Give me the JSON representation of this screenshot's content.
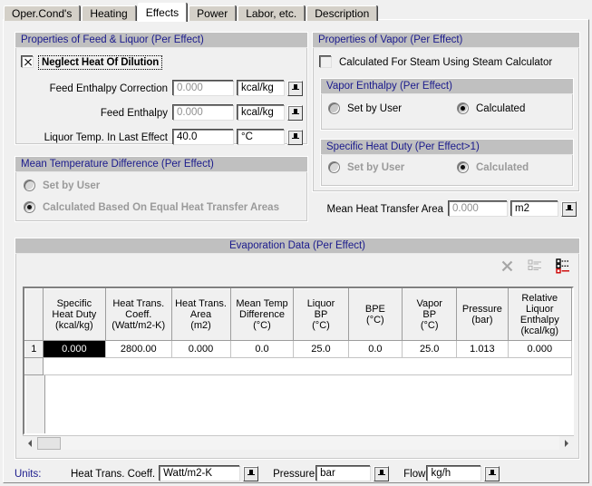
{
  "window": {
    "title": "Effects"
  },
  "tabs": [
    {
      "label": "Oper.Cond's",
      "active": false
    },
    {
      "label": "Heating",
      "active": false
    },
    {
      "label": "Effects",
      "active": true
    },
    {
      "label": "Power",
      "active": false
    },
    {
      "label": "Labor, etc.",
      "active": false
    },
    {
      "label": "Description",
      "active": false
    }
  ],
  "feed_liquor": {
    "title": "Properties of Feed & Liquor (Per Effect)",
    "neglect_checkbox": {
      "label": "Neglect Heat Of Dilution",
      "checked": true,
      "focused": true
    },
    "rows": [
      {
        "label": "Feed Enthalpy Correction",
        "value": "0.000",
        "unit": "kcal/kg",
        "disabled": true
      },
      {
        "label": "Feed Enthalpy",
        "value": "0.000",
        "unit": "kcal/kg",
        "disabled": true
      },
      {
        "label": "Liquor Temp. In Last Effect",
        "value": "40.0",
        "unit": "°C",
        "disabled": false
      }
    ]
  },
  "mean_temp_diff": {
    "title": "Mean Temperature Difference (Per Effect)",
    "options": [
      {
        "label": "Set by User",
        "selected": false,
        "disabled": true
      },
      {
        "label": "Calculated Based On Equal Heat Transfer Areas",
        "selected": true,
        "disabled": true
      }
    ]
  },
  "vapor": {
    "title": "Properties of Vapor (Per Effect)",
    "steam_checkbox": {
      "label": "Calculated For Steam Using Steam Calculator",
      "checked": false,
      "disabled": true
    },
    "vapor_enthalpy": {
      "title": "Vapor Enthalpy (Per Effect)",
      "options": [
        {
          "label": "Set by User",
          "selected": false,
          "disabled": false
        },
        {
          "label": "Calculated",
          "selected": true,
          "disabled": false
        }
      ]
    },
    "specific_heat_duty": {
      "title": "Specific Heat Duty (Per Effect>1)",
      "options": [
        {
          "label": "Set by User",
          "selected": false,
          "disabled": true
        },
        {
          "label": "Calculated",
          "selected": true,
          "disabled": true
        }
      ]
    }
  },
  "mean_heat_transfer_area": {
    "label": "Mean Heat Transfer Area",
    "value": "0.000",
    "unit": "m2",
    "disabled": true
  },
  "evaporation_data": {
    "title": "Evaporation Data (Per Effect)",
    "toolbar": [
      {
        "name": "delete-row-icon",
        "label": "X",
        "enabled": false
      },
      {
        "name": "list-view-icon",
        "label": "list",
        "enabled": false
      },
      {
        "name": "detail-view-icon",
        "label": "detail",
        "enabled": true
      }
    ],
    "columns": [
      {
        "name": "row-number",
        "lines": [
          ""
        ]
      },
      {
        "name": "specific-heat-duty",
        "lines": [
          "Specific",
          "Heat Duty",
          "(kcal/kg)"
        ]
      },
      {
        "name": "heat-trans-coeff",
        "lines": [
          "Heat Trans.",
          "Coeff.",
          "(Watt/m2-K)"
        ]
      },
      {
        "name": "heat-trans-area",
        "lines": [
          "Heat Trans.",
          "Area",
          "(m2)"
        ]
      },
      {
        "name": "mean-temp-difference",
        "lines": [
          "Mean Temp",
          "Difference",
          "(°C)"
        ]
      },
      {
        "name": "liquor-bp",
        "lines": [
          "Liquor",
          "BP",
          "(°C)"
        ]
      },
      {
        "name": "bpe",
        "lines": [
          "BPE",
          "(°C)"
        ]
      },
      {
        "name": "vapor-bp",
        "lines": [
          "Vapor",
          "BP",
          "(°C)"
        ]
      },
      {
        "name": "pressure",
        "lines": [
          "Pressure",
          "(bar)"
        ]
      },
      {
        "name": "relative-liquor-enthalpy",
        "lines": [
          "Relative",
          "Liquor",
          "Enthalpy",
          "(kcal/kg)"
        ]
      }
    ],
    "rows": [
      {
        "number": "1",
        "cells": [
          "0.000",
          "2800.00",
          "0.000",
          "0.0",
          "25.0",
          "0.0",
          "25.0",
          "1.013",
          "0.000"
        ],
        "selected_cell_index": 0
      }
    ]
  },
  "units_bar": {
    "label": "Units:",
    "fields": [
      {
        "label": "Heat Trans. Coeff.",
        "value": "Watt/m2-K"
      },
      {
        "label": "Pressure",
        "value": "bar"
      },
      {
        "label": "Flow",
        "value": "kg/h"
      }
    ]
  },
  "colors": {
    "group_title_text": "#1a1a8c",
    "group_title_bg": "#c0c0c0",
    "page_bg": "#f0f0f0",
    "selected_cell_bg": "#000000",
    "accent_red": "#cc0000",
    "disabled_text": "#9a9a9a"
  }
}
